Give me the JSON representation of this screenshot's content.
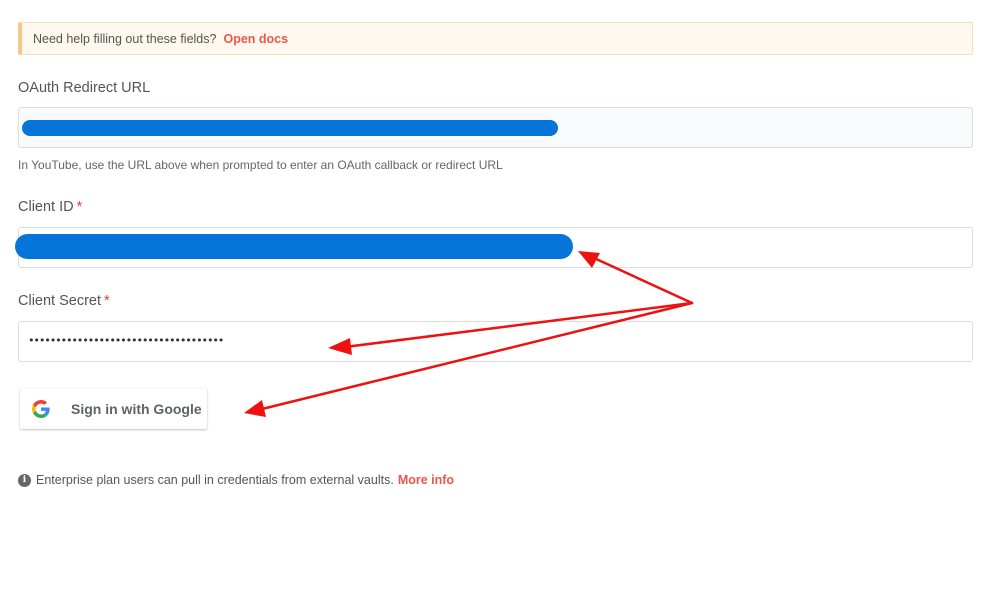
{
  "help_banner": {
    "text": "Need help filling out these fields?",
    "link_label": "Open docs"
  },
  "oauth_redirect": {
    "label": "OAuth Redirect URL",
    "hint": "In YouTube, use the URL above when prompted to enter an OAuth callback or redirect URL"
  },
  "client_id": {
    "label": "Client ID",
    "required_mark": "*"
  },
  "client_secret": {
    "label": "Client Secret",
    "required_mark": "*",
    "masked_value": "••••••••••••••••••••••••••••••••••••"
  },
  "google_button": {
    "label": "Sign in with Google",
    "icon": "google-g-icon"
  },
  "enterprise_note": {
    "text": "Enterprise plan users can pull in credentials from external vaults.",
    "link_label": "More info",
    "icon": "info-icon"
  },
  "colors": {
    "link": "#e8574b",
    "redaction": "#0674d8",
    "annotation_arrow": "#ee1111",
    "banner_bg": "#fef8ee"
  }
}
